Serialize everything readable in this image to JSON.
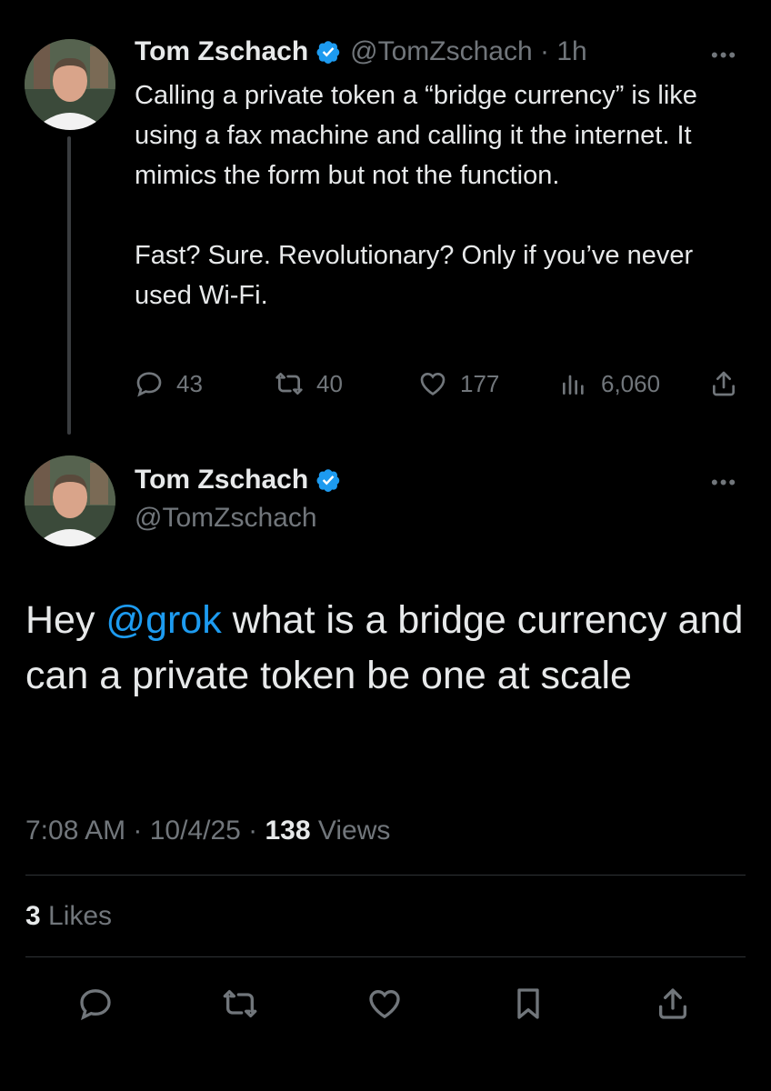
{
  "reply_parent": {
    "author_name": "Tom Zschach",
    "handle_time": "@TomZschach · 1h",
    "text": "Calling a private token a “bridge currency” is like using a fax machine and calling it the internet. It mimics the form but not the function.\n\nFast? Sure. Revolutionary? Only if you’ve never used Wi-Fi.",
    "actions": {
      "replies": "43",
      "reposts": "40",
      "likes": "177",
      "views": "6,060"
    }
  },
  "main_tweet": {
    "author_name": "Tom Zschach",
    "handle": "@TomZschach",
    "text_prefix": "Hey ",
    "mention": "@grok",
    "text_suffix": " what is a bridge currency and can a private token be one at scale",
    "time_date": "7:08 AM · 10/4/25 · ",
    "views_count": "138",
    "views_label": " Views",
    "likes_count": "3",
    "likes_label": " Likes"
  },
  "colors": {
    "background": "#000000",
    "text": "#e7e9ea",
    "muted": "#71767b",
    "accent": "#1d9bf0",
    "divider": "#2f3336"
  },
  "icons": [
    "verified-badge-icon",
    "more-icon",
    "reply-icon",
    "repost-icon",
    "like-icon",
    "views-icon",
    "share-icon",
    "bookmark-icon"
  ]
}
